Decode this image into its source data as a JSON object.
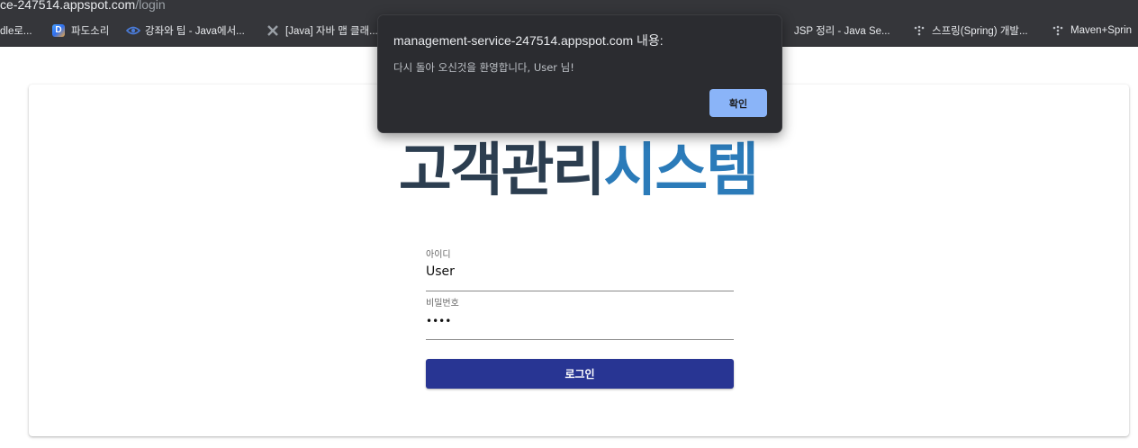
{
  "browser": {
    "address_host": "ce-247514.appspot.com",
    "address_path": "/login",
    "bookmarks": [
      {
        "label": "dle로...",
        "icon": "none"
      },
      {
        "label": "파도소리",
        "icon": "d-logo-icon"
      },
      {
        "label": "강좌와 팁 - Java에서...",
        "icon": "eye-icon"
      },
      {
        "label": "[Java] 자바 맵 클래...",
        "icon": "x-logo-icon"
      },
      {
        "label": "JSP 정리 - Java Se...",
        "icon": "none"
      },
      {
        "label": "스프링(Spring) 개발...",
        "icon": "dots-icon"
      },
      {
        "label": "Maven+Sprin",
        "icon": "dots-icon"
      }
    ]
  },
  "page": {
    "title_part1": "고객관리",
    "title_part2": "시스템",
    "title_color1": "#2c3e50",
    "title_color2": "#2b7bb9"
  },
  "form": {
    "id_label": "아이디",
    "id_value": "User",
    "pw_label": "비밀번호",
    "pw_value": "••••",
    "login_label": "로그인",
    "button_color": "#283593"
  },
  "dialog": {
    "title": "management-service-247514.appspot.com 내용:",
    "message": "다시 돌아 오신것을 환영합니다, User 님!",
    "ok_label": "확인",
    "ok_color": "#8ab4f8"
  }
}
